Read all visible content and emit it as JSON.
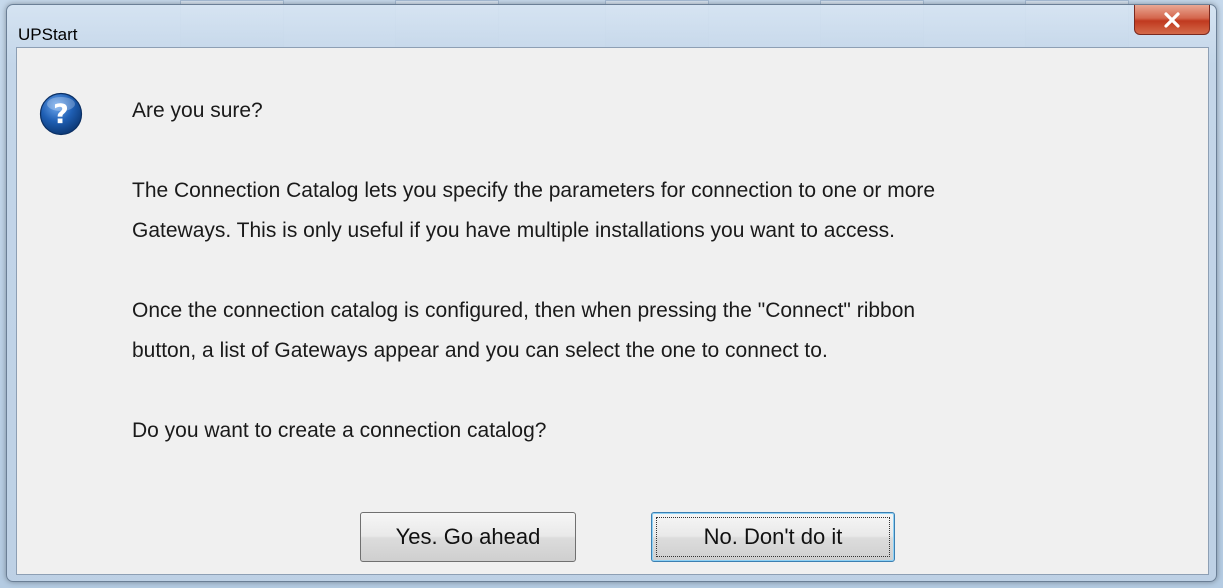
{
  "window": {
    "title": "UPStart"
  },
  "dialog": {
    "icon": "question-icon",
    "heading": "Are you sure?",
    "paragraph1_line1": "The Connection Catalog lets you specify the parameters for connection to one or more",
    "paragraph1_line2": "Gateways. This is only useful if you have multiple installations you want to access.",
    "paragraph2_line1": "Once the connection catalog is configured, then when pressing the \"Connect\" ribbon",
    "paragraph2_line2": "button, a list of Gateways appear and you can select the one to connect to.",
    "question": "Do you want to create a connection catalog?"
  },
  "buttons": {
    "yes_label": "Yes. Go ahead",
    "no_label": "No. Don't do it",
    "close_icon": "close-icon"
  },
  "colors": {
    "close_button": "#c0391f",
    "icon_blue": "#1f5fb4",
    "client_bg": "#f0f0f0"
  }
}
